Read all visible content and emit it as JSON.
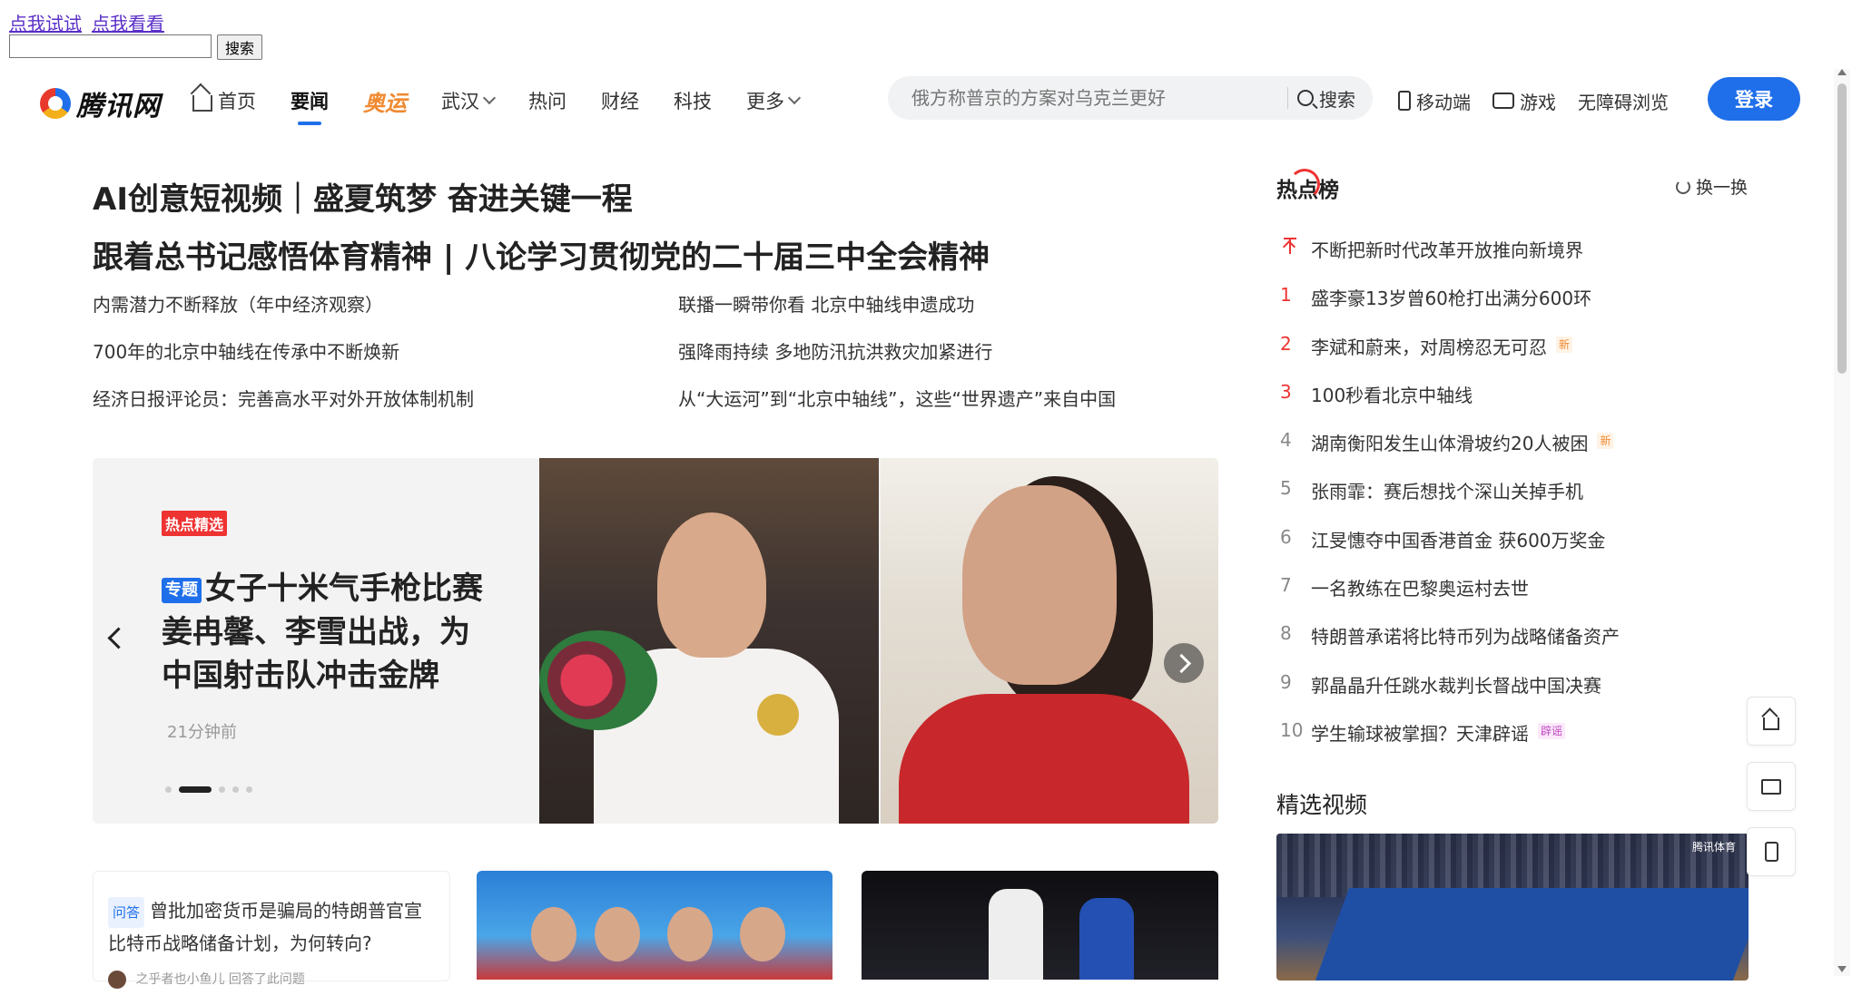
{
  "debug": {
    "links": [
      "点我试试",
      "点我看看"
    ],
    "search_value": "",
    "search_button": "搜索"
  },
  "header": {
    "logo_text": "腾讯网",
    "nav": [
      {
        "label": "首页",
        "icon": "home-icon"
      },
      {
        "label": "要闻",
        "active": true
      },
      {
        "label": "奥运"
      },
      {
        "label": "武汉",
        "dropdown": true
      },
      {
        "label": "热问"
      },
      {
        "label": "财经"
      },
      {
        "label": "科技"
      },
      {
        "label": "更多",
        "dropdown": true
      }
    ],
    "search_placeholder": "俄方称普京的方案对乌克兰更好",
    "search_button": "搜索",
    "right": [
      {
        "label": "移动端",
        "icon": "phone-icon"
      },
      {
        "label": "游戏",
        "icon": "game-icon"
      },
      {
        "label": "无障碍浏览"
      }
    ],
    "login": "登录",
    "accent": "#1f6fea",
    "olympic_color": "#f08a30"
  },
  "main": {
    "headline1": "AI创意短视频｜盛夏筑梦 奋进关键一程",
    "headline2": "跟着总书记感悟体育精神 | 八论学习贯彻党的二十届三中全会精神",
    "news": [
      "内需潜力不断释放（年中经济观察）",
      "联播一瞬带你看 北京中轴线申遗成功",
      "700年的北京中轴线在传承中不断焕新",
      "强降雨持续 多地防汛抗洪救灾加紧进行",
      "经济日报评论员：完善高水平对外开放体制机制",
      "从“大运河”到“北京中轴线”，这些“世界遗产”来自中国"
    ],
    "carousel": {
      "tag": "热点精选",
      "topic_badge": "专题",
      "title": "女子十米气手枪比赛姜冉馨、李雪出战，为中国射击队冲击金牌",
      "time": "21分钟前",
      "slide_count": 5,
      "active_slide": 1
    },
    "cards": {
      "qa_tag": "问答",
      "qa_title": "曾批加密货币是骗局的特朗普官宣比特币战略储备计划，为何转向?",
      "qa_author": "之乎者也小鱼儿",
      "qa_action": "回答了此问题"
    }
  },
  "sidebar": {
    "hot_title": "热点榜",
    "refresh": "换一换",
    "hot_list": [
      {
        "rank": "",
        "title": "不断把新时代改革开放推向新境界",
        "pinned": true
      },
      {
        "rank": "1",
        "title": "盛李豪13岁曾60枪打出满分600环"
      },
      {
        "rank": "2",
        "title": "李斌和蔚来，对周榜忍无可忍",
        "badge": "新"
      },
      {
        "rank": "3",
        "title": "100秒看北京中轴线"
      },
      {
        "rank": "4",
        "title": "湖南衡阳发生山体滑坡约20人被困",
        "badge": "新"
      },
      {
        "rank": "5",
        "title": "张雨霏：赛后想找个深山关掉手机"
      },
      {
        "rank": "6",
        "title": "江旻憓夺中国香港首金 获600万奖金"
      },
      {
        "rank": "7",
        "title": "一名教练在巴黎奥运村去世"
      },
      {
        "rank": "8",
        "title": "特朗普承诺将比特币列为战略储备资产"
      },
      {
        "rank": "9",
        "title": "郭晶晶升任跳水裁判长督战中国决赛"
      },
      {
        "rank": "10",
        "title": "学生输球被掌掴？天津辟谣",
        "badge": "辟谣"
      }
    ],
    "video_title": "精选视频",
    "video_watermark": "腾讯体育"
  }
}
